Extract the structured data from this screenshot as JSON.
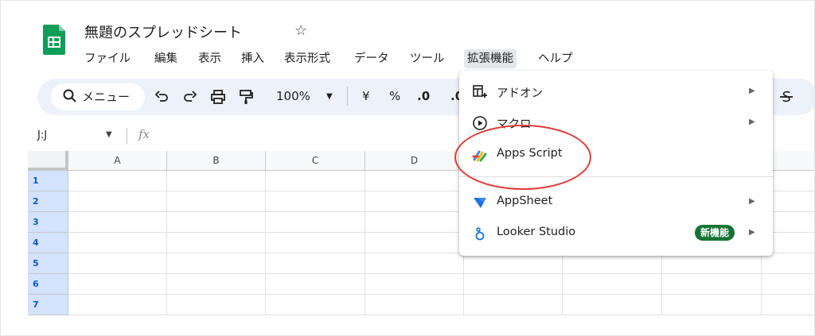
{
  "app": {
    "title": "無題のスプレッドシート"
  },
  "menubar": {
    "items": [
      "ファイル",
      "編集",
      "表示",
      "挿入",
      "表示形式",
      "データ",
      "ツール",
      "拡張機能",
      "ヘルプ"
    ],
    "active_index": 7
  },
  "toolbar": {
    "search_label": "メニュー",
    "zoom": "100%",
    "currency": "¥",
    "percent": "%",
    "decrease_decimal": ".0",
    "increase_decimal": ".0"
  },
  "formula_bar": {
    "namebox": "J:J",
    "fx": "fx"
  },
  "grid": {
    "columns": [
      "A",
      "B",
      "C",
      "D",
      "",
      "",
      "",
      ""
    ],
    "rows": [
      "1",
      "2",
      "3",
      "4",
      "5",
      "6",
      "7"
    ]
  },
  "extensions_menu": {
    "items": [
      {
        "label": "アドオン",
        "icon": "addon-icon",
        "has_submenu": true
      },
      {
        "label": "マクロ",
        "icon": "macro-icon",
        "has_submenu": true
      },
      {
        "label": "Apps Script",
        "icon": "apps-script-icon",
        "has_submenu": false
      },
      {
        "label": "AppSheet",
        "icon": "appsheet-icon",
        "has_submenu": true
      },
      {
        "label": "Looker Studio",
        "icon": "looker-studio-icon",
        "has_submenu": true,
        "badge": "新機能"
      }
    ]
  },
  "colors": {
    "sheets_green": "#0f9d58",
    "toolbar_bg": "#edf2fa",
    "row_header_selected": "#d3e3fd",
    "badge_green": "#137333",
    "annotation_red": "#e53935"
  }
}
